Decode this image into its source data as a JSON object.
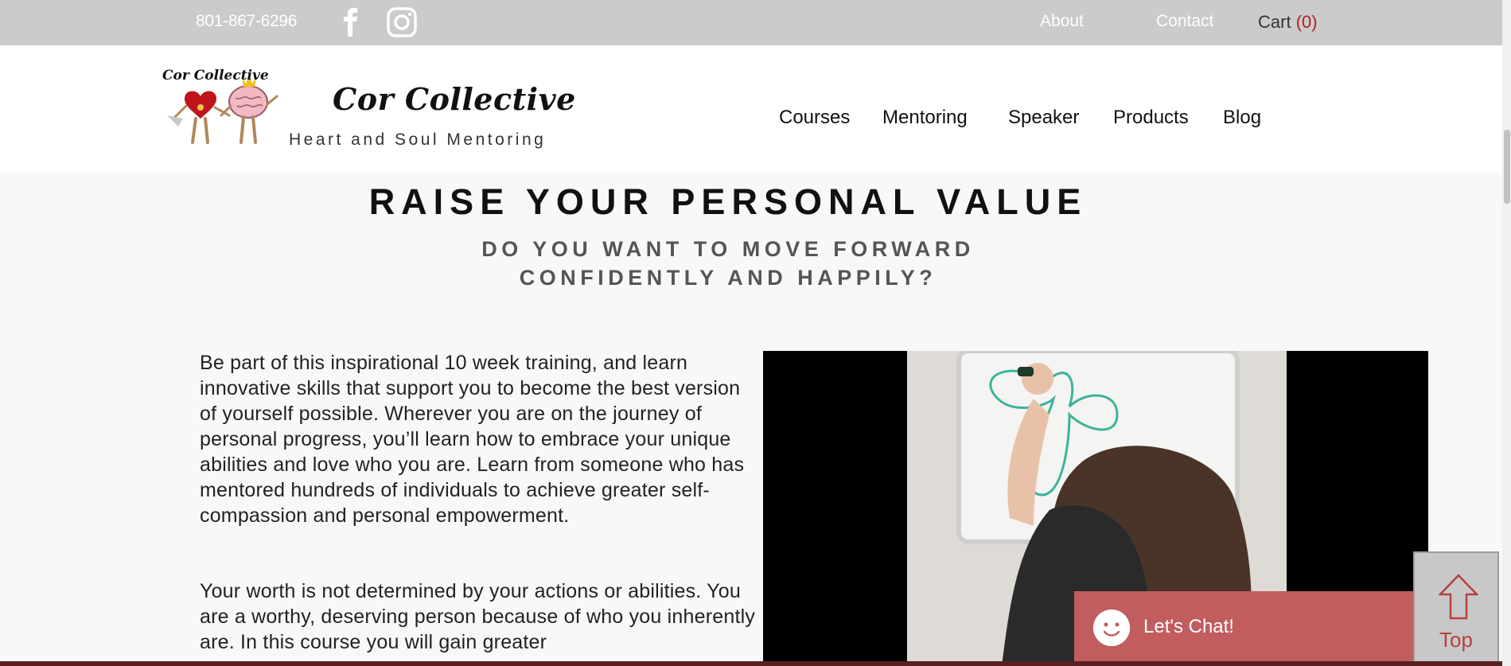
{
  "topbar": {
    "phone": "801-867-6296",
    "about_label": "About",
    "contact_label": "Contact",
    "cart_label": "Cart",
    "cart_count": "(0)",
    "social_icons": [
      "facebook-icon",
      "instagram-icon"
    ]
  },
  "header": {
    "logo_text": "Cor Collective",
    "brand": "Cor Collective",
    "tagline": "Heart and Soul Mentoring",
    "nav": [
      "Courses",
      "Mentoring",
      "Speaker",
      "Products",
      "Blog"
    ]
  },
  "main": {
    "heading": "RAISE YOUR PERSONAL VALUE",
    "subheading_line1": "DO YOU WANT TO MOVE FORWARD",
    "subheading_line2": "CONFIDENTLY AND HAPPILY?",
    "paragraph1": "Be part of this inspirational 10 week training, and learn innovative skills that support you to become the best version of yourself possible. Wherever you are on the journey of personal progress, you’ll learn how to embrace your unique abilities and love who you are. Learn from someone who has mentored hundreds of individuals to achieve greater self-compassion and personal empowerment.",
    "paragraph2": "Your worth is not determined by your actions or abilities. You are a worthy, deserving person because of who you inherently are. In this course you will gain greater"
  },
  "chat": {
    "label": "Let's Chat!"
  },
  "top_button": {
    "label": "Top"
  },
  "colors": {
    "topbar": "#cbcbcb",
    "accent": "#c15c5f",
    "cart_count": "#b22222"
  }
}
